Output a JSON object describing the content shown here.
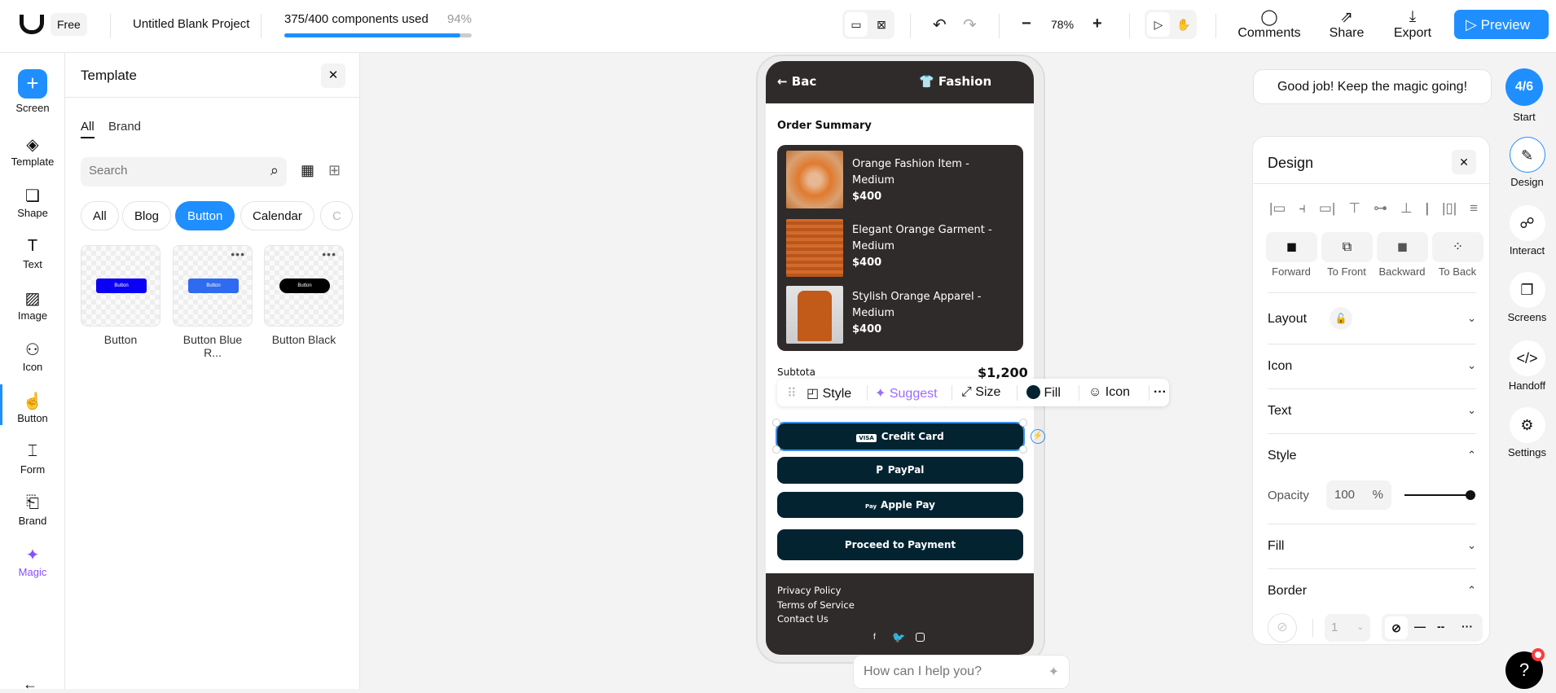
{
  "topbar": {
    "plan": "Free",
    "project": "Untitled Blank Project",
    "usage_label": "375/400 components used",
    "usage_percent": "94%",
    "usage_fraction": 0.94,
    "zoom": "78%",
    "comments": "Comments",
    "share": "Share",
    "export": "Export",
    "preview": "Preview"
  },
  "rail": [
    {
      "label": "Screen"
    },
    {
      "label": "Template"
    },
    {
      "label": "Shape"
    },
    {
      "label": "Text"
    },
    {
      "label": "Image"
    },
    {
      "label": "Icon"
    },
    {
      "label": "Button"
    },
    {
      "label": "Form"
    },
    {
      "label": "Brand"
    },
    {
      "label": "Magic"
    }
  ],
  "template": {
    "title": "Template",
    "tabs": [
      "All",
      "Brand"
    ],
    "search_placeholder": "Search",
    "chips": [
      "All",
      "Blog",
      "Button",
      "Calendar",
      "C"
    ],
    "cards": [
      {
        "label": "Button",
        "preview": "Button",
        "color": "#0a00f5"
      },
      {
        "label": "Button Blue R...",
        "preview": "Button",
        "color": "#2f6bf0"
      },
      {
        "label": "Button Black",
        "preview": "Button",
        "color": "#000000"
      }
    ]
  },
  "phone": {
    "back": "Bac",
    "title": "Fashion",
    "section": "Order Summary",
    "items": [
      {
        "name": "Orange Fashion Item - Medium",
        "price": "$400"
      },
      {
        "name": "Elegant Orange Garment - Medium",
        "price": "$400"
      },
      {
        "name": "Stylish Orange Apparel - Medium",
        "price": "$400"
      }
    ],
    "subtotal_label": "Subtota",
    "subtotal": "$1,200",
    "pay": {
      "credit": "Credit Card",
      "visa": "VISA",
      "paypal": "PayPal",
      "apple": "Apple Pay",
      "apple_icon": "Pay",
      "proceed": "Proceed to Payment"
    },
    "footer": [
      "Privacy Policy",
      "Terms of Service",
      "Contact Us"
    ]
  },
  "toolbar": {
    "style": "Style",
    "suggest": "Suggest",
    "size": "Size",
    "fill": "Fill",
    "icon": "Icon",
    "fill_color": "#032331"
  },
  "toast": "Good job! Keep the magic going!",
  "progress": {
    "value": "4/6",
    "label": "Start"
  },
  "design": {
    "title": "Design",
    "layers": [
      "Forward",
      "To Front",
      "Backward",
      "To Back"
    ],
    "sections": {
      "layout": "Layout",
      "icon": "Icon",
      "text": "Text",
      "style": "Style",
      "fill": "Fill",
      "border": "Border"
    },
    "opacity_label": "Opacity",
    "opacity": "100",
    "opacity_unit": "%",
    "border_width": "1"
  },
  "right_rail": [
    {
      "label": "Design"
    },
    {
      "label": "Interact"
    },
    {
      "label": "Screens"
    },
    {
      "label": "Handoff"
    },
    {
      "label": "Settings"
    }
  ],
  "chat_placeholder": "How can I help you?",
  "help": "?"
}
